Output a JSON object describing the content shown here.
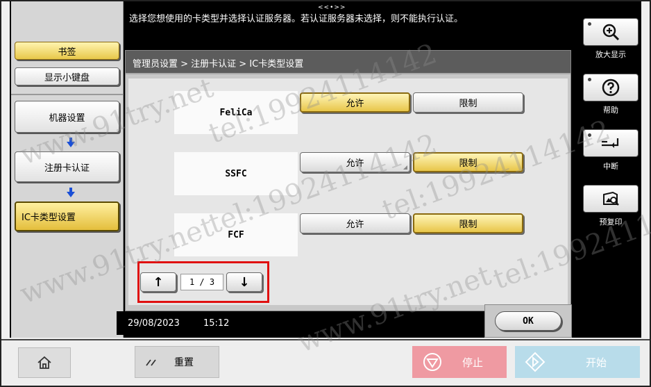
{
  "top_message": "选择您想使用的卡类型并选择认证服务器。若认证服务器未选择，则不能执行认证。",
  "top_dots": "<<•>>",
  "left_panel": {
    "bookmark_label": "书签",
    "keypad_label": "显示小键盘",
    "items": [
      {
        "label": "机器设置"
      },
      {
        "label": "注册卡认证"
      },
      {
        "label": "IC卡类型设置"
      }
    ]
  },
  "breadcrumb": "管理员设置 > 注册卡认证 > IC卡类型设置",
  "card_types": [
    {
      "name": "FeliCa",
      "selected": "allow"
    },
    {
      "name": "SSFC",
      "selected": "restrict"
    },
    {
      "name": "FCF",
      "selected": "restrict"
    }
  ],
  "allow_label": "允许",
  "restrict_label": "限制",
  "pager": {
    "text": "1 / 3",
    "up": "↑",
    "down": "↓"
  },
  "status": {
    "date": "29/08/2023",
    "time": "15:12"
  },
  "ok_label": "OK",
  "right_panel": {
    "zoom_label": "放大显示",
    "help_label": "帮助",
    "interrupt_label": "中断",
    "preview_label": "预复印"
  },
  "bottom": {
    "reset_label": "重置",
    "stop_label": "停止",
    "start_label": "开始"
  },
  "watermarks": [
    "www.91try.net",
    "tel:19924114142"
  ]
}
